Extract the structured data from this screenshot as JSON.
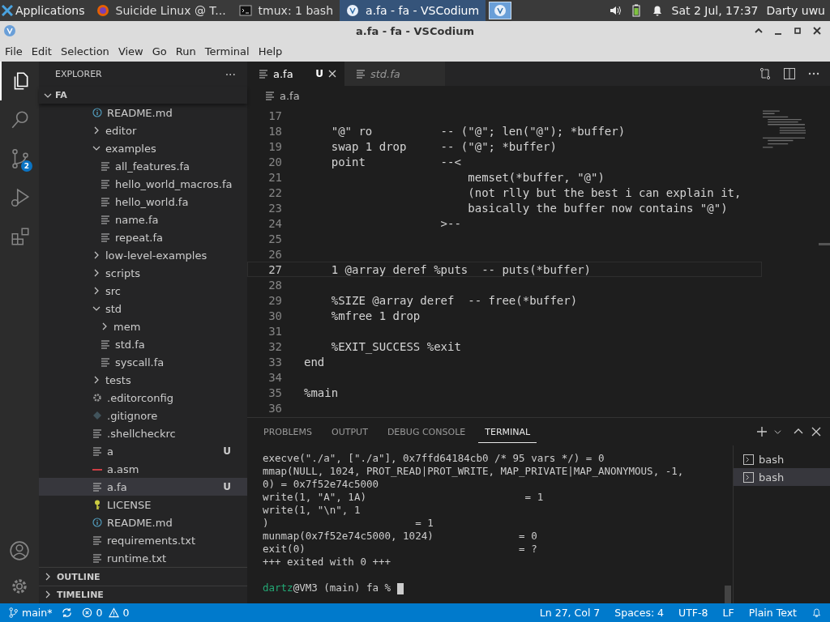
{
  "taskbar": {
    "menu": "Applications",
    "tasks": [
      {
        "kind": "browser",
        "label": "Suicide Linux @ T...",
        "selected": false
      },
      {
        "kind": "terminal",
        "label": "tmux: 1 bash",
        "selected": false
      },
      {
        "kind": "codium",
        "label": "a.fa - fa - VSCodium",
        "selected": true
      }
    ],
    "clock": "Sat  2 Jul, 17:37",
    "user": "Darty uwu"
  },
  "window": {
    "title": "a.fa - fa - VSCodium"
  },
  "menu": [
    "File",
    "Edit",
    "Selection",
    "View",
    "Go",
    "Run",
    "Terminal",
    "Help"
  ],
  "activity": [
    {
      "kind": "explorer",
      "selected": true
    },
    {
      "kind": "search",
      "selected": false
    },
    {
      "kind": "scm",
      "selected": false,
      "badge": "2"
    },
    {
      "kind": "debug",
      "selected": false
    },
    {
      "kind": "extensions",
      "selected": false
    }
  ],
  "sidebar": {
    "title": "EXPLORER",
    "more": "···",
    "root": {
      "label": "FA",
      "expanded": true,
      "children": [
        {
          "kind": "info",
          "label": "README.md"
        },
        {
          "kind": "folder",
          "label": "editor",
          "expanded": false
        },
        {
          "kind": "folder",
          "label": "examples",
          "expanded": true,
          "children": [
            {
              "kind": "text",
              "label": "all_features.fa"
            },
            {
              "kind": "text",
              "label": "hello_world_macros.fa"
            },
            {
              "kind": "text",
              "label": "hello_world.fa"
            },
            {
              "kind": "text",
              "label": "name.fa"
            },
            {
              "kind": "text",
              "label": "repeat.fa"
            }
          ]
        },
        {
          "kind": "folder",
          "label": "low-level-examples",
          "expanded": false
        },
        {
          "kind": "folder",
          "label": "scripts",
          "expanded": false
        },
        {
          "kind": "folder",
          "label": "src",
          "expanded": false
        },
        {
          "kind": "folder",
          "label": "std",
          "expanded": true,
          "children": [
            {
              "kind": "folder",
              "label": "mem",
              "expanded": false
            },
            {
              "kind": "text",
              "label": "std.fa"
            },
            {
              "kind": "text",
              "label": "syscall.fa"
            }
          ]
        },
        {
          "kind": "folder",
          "label": "tests",
          "expanded": false
        },
        {
          "kind": "config",
          "label": ".editorconfig"
        },
        {
          "kind": "git",
          "label": ".gitignore"
        },
        {
          "kind": "text",
          "label": ".shellcheckrc"
        },
        {
          "kind": "text",
          "label": "a",
          "badge": "U"
        },
        {
          "kind": "asm",
          "label": "a.asm"
        },
        {
          "kind": "text",
          "label": "a.fa",
          "badge": "U",
          "selected": true
        },
        {
          "kind": "license",
          "label": "LICENSE"
        },
        {
          "kind": "info",
          "label": "README.md"
        },
        {
          "kind": "text",
          "label": "requirements.txt"
        },
        {
          "kind": "text",
          "label": "runtime.txt"
        }
      ]
    },
    "sections": [
      {
        "label": "OUTLINE",
        "expanded": false
      },
      {
        "label": "TIMELINE",
        "expanded": false
      }
    ]
  },
  "editor": {
    "tabs": [
      {
        "label": "a.fa",
        "badge": "U",
        "selected": true,
        "preview": false
      },
      {
        "label": "std.fa",
        "selected": false,
        "preview": true
      }
    ],
    "breadcrumb": "a.fa",
    "lines": [
      {
        "number": "17"
      },
      {
        "number": "18",
        "text": "    \"@\" ro          -- (\"@\"; len(\"@\"); *buffer)"
      },
      {
        "number": "19",
        "text": "    swap 1 drop     -- (\"@\"; *buffer)"
      },
      {
        "number": "20",
        "text": "    point           --<"
      },
      {
        "number": "21",
        "text": "                        memset(*buffer, \"@\")"
      },
      {
        "number": "22",
        "text": "                        (not rlly but the best i can explain it,"
      },
      {
        "number": "23",
        "text": "                        basically the buffer now contains \"@\")"
      },
      {
        "number": "24",
        "text": "                    >--"
      },
      {
        "number": "25"
      },
      {
        "number": "26"
      },
      {
        "number": "27",
        "text": "    1 @array deref %puts  -- puts(*buffer)",
        "current": true
      },
      {
        "number": "28"
      },
      {
        "number": "29",
        "text": "    %SIZE @array deref  -- free(*buffer)"
      },
      {
        "number": "30",
        "text": "    %mfree 1 drop"
      },
      {
        "number": "31"
      },
      {
        "number": "32",
        "text": "    %EXIT_SUCCESS %exit"
      },
      {
        "number": "33",
        "text": "end"
      },
      {
        "number": "34"
      },
      {
        "number": "35",
        "text": "%main"
      },
      {
        "number": "36"
      }
    ]
  },
  "panel": {
    "tabs": [
      {
        "label": "PROBLEMS",
        "selected": false
      },
      {
        "label": "OUTPUT",
        "selected": false
      },
      {
        "label": "DEBUG CONSOLE",
        "selected": false
      },
      {
        "label": "TERMINAL",
        "selected": true
      }
    ],
    "terminal": [
      "execve(\"./a\", [\"./a\"], 0x7ffd64184cb0 /* 95 vars */) = 0",
      "mmap(NULL, 1024, PROT_READ|PROT_WRITE, MAP_PRIVATE|MAP_ANONYMOUS, -1,",
      "0) = 0x7f52e74c5000",
      "write(1, \"A\", 1A)                          = 1",
      "write(1, \"\\n\", 1",
      ")                        = 1",
      "munmap(0x7f52e74c5000, 1024)              = 0",
      "exit(0)                                   = ?",
      "+++ exited with 0 +++"
    ],
    "prompt": {
      "user": "dartz",
      "rest": "@VM3 (main) fa % "
    },
    "shells": [
      {
        "label": "bash",
        "selected": false
      },
      {
        "label": "bash",
        "selected": true
      }
    ]
  },
  "status_bar": {
    "branch": "main*",
    "errors": "0",
    "warnings": "0",
    "right": [
      "Ln 27, Col 7",
      "Spaces: 4",
      "UTF-8",
      "LF",
      "Plain Text"
    ]
  }
}
